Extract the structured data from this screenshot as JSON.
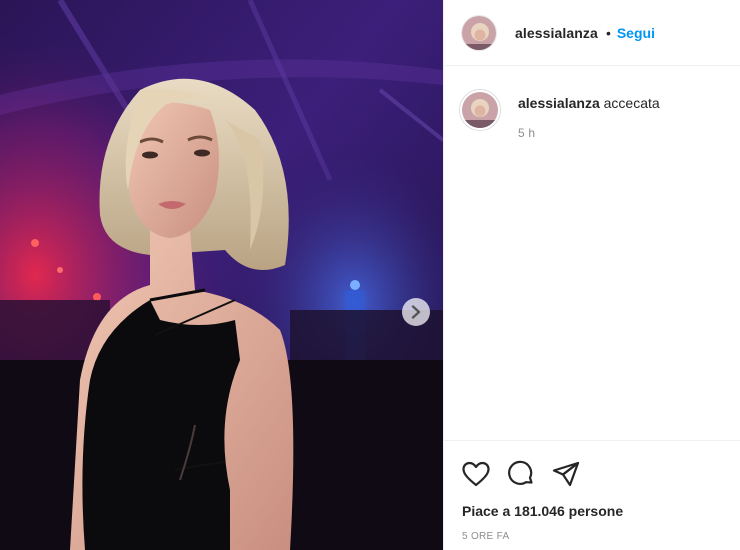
{
  "post": {
    "username": "alessialanza",
    "separator": "•",
    "follow_label": "Segui"
  },
  "caption": {
    "username": "alessialanza",
    "text": "accecata",
    "time": "5 h"
  },
  "actions": {
    "icons": [
      "heart-icon",
      "comment-icon",
      "share-icon"
    ]
  },
  "likes": {
    "text": "Piace a 181.046 persone"
  },
  "timeago": "5 ORE FA",
  "media": {
    "next_icon": "chevron-right-icon"
  },
  "colors": {
    "accent": "#0095f6",
    "text": "#262626",
    "muted": "#8e8e8e",
    "border": "#efefef"
  }
}
